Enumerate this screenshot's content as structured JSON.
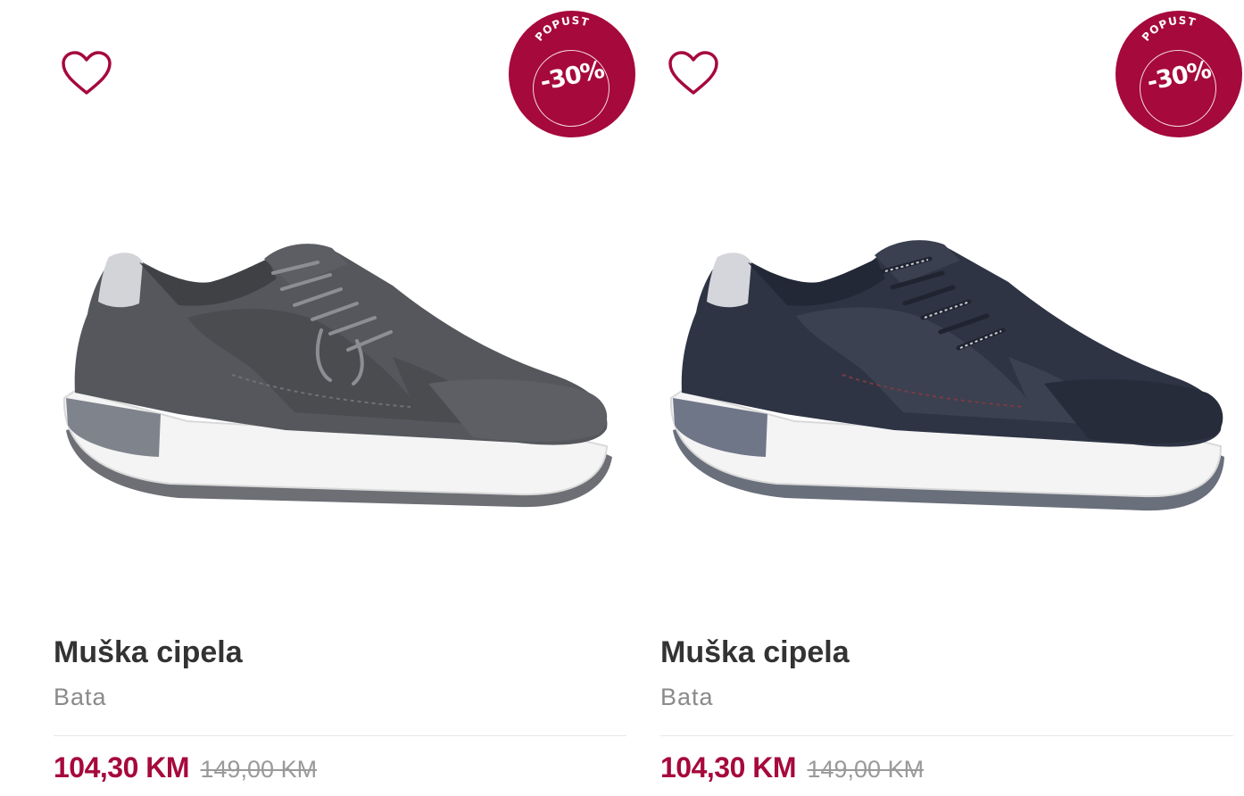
{
  "colors": {
    "accent": "#a6093c",
    "title": "#333333",
    "muted": "#8a8a8a"
  },
  "products": [
    {
      "name": "Muška cipela",
      "brand": "Bata",
      "price": "104,30 KM",
      "old_price": "149,00 KM",
      "badge_label": "POPUST",
      "badge_value": "-30%",
      "image": "grey-sneaker",
      "wishlist_icon": "heart-outline-icon"
    },
    {
      "name": "Muška cipela",
      "brand": "Bata",
      "price": "104,30 KM",
      "old_price": "149,00 KM",
      "badge_label": "POPUST",
      "badge_value": "-30%",
      "image": "navy-sneaker",
      "wishlist_icon": "heart-outline-icon"
    }
  ]
}
